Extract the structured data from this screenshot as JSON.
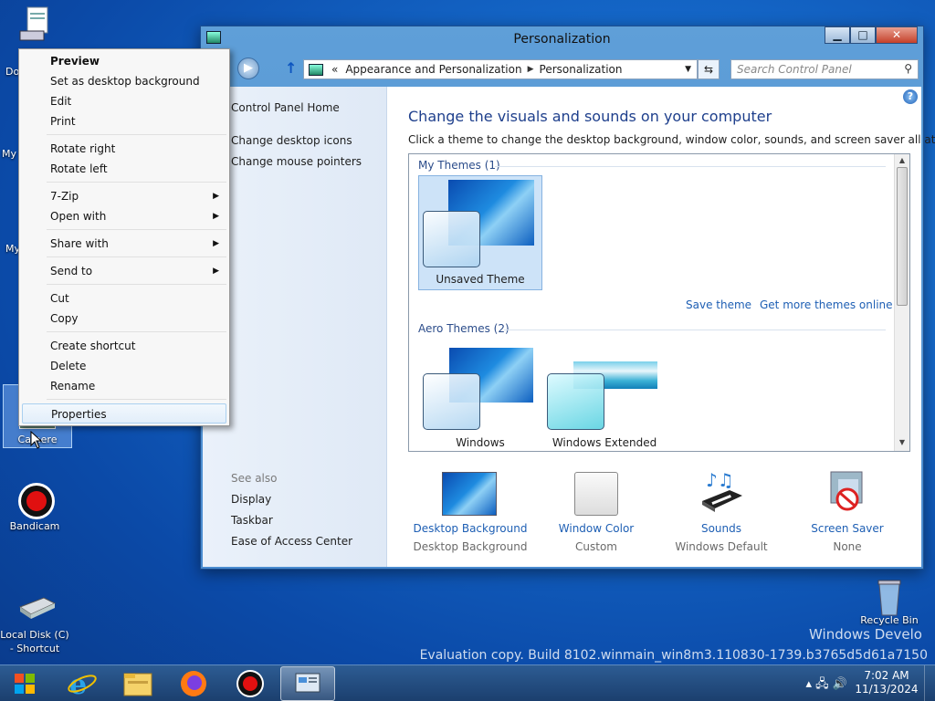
{
  "desktop": {
    "icons": {
      "documents": {
        "label": "Do"
      },
      "my1": {
        "label": "My"
      },
      "my2": {
        "label": "My"
      },
      "camera": {
        "label": "Camere"
      },
      "bandicam": {
        "label": "Bandicam"
      },
      "local_disk": {
        "label": "Local Disk (C)\n- Shortcut"
      },
      "recycle": {
        "label": "Recycle Bin"
      }
    },
    "watermark": {
      "line1": "Windows Develo",
      "line2": "Evaluation copy. Build 8102.winmain_win8m3.110830-1739.b3765d5d61a7150"
    }
  },
  "context_menu": {
    "items": [
      {
        "label": "Preview",
        "bold": true
      },
      {
        "label": "Set as desktop background"
      },
      {
        "label": "Edit"
      },
      {
        "label": "Print"
      },
      {
        "label": "Rotate right"
      },
      {
        "label": "Rotate left"
      },
      {
        "label": "7-Zip",
        "submenu": true
      },
      {
        "label": "Open with",
        "submenu": true
      },
      {
        "label": "Share with",
        "submenu": true
      },
      {
        "label": "Send to",
        "submenu": true
      },
      {
        "label": "Cut"
      },
      {
        "label": "Copy"
      },
      {
        "label": "Create shortcut"
      },
      {
        "label": "Delete"
      },
      {
        "label": "Rename"
      },
      {
        "label": "Properties",
        "hovered": true
      }
    ]
  },
  "window": {
    "title": "Personalization",
    "controls": {
      "minimize": "▁",
      "maximize": "□",
      "close": "✕"
    },
    "address": {
      "breadcrumb": [
        "Appearance and Personalization",
        "Personalization"
      ],
      "prefix": "«"
    },
    "search": {
      "placeholder": "Search Control Panel"
    },
    "left_pane": {
      "home": "Control Panel Home",
      "links": [
        "Change desktop icons",
        "Change mouse pointers"
      ],
      "see_also": "See also",
      "see_also_links": [
        "Display",
        "Taskbar",
        "Ease of Access Center"
      ]
    },
    "main": {
      "title": "Change the visuals and sounds on your computer",
      "description": "Click a theme to change the desktop background, window color, sounds, and screen saver all at once.",
      "groups": {
        "my_themes": {
          "label": "My Themes (1)",
          "items": [
            "Unsaved Theme"
          ]
        },
        "aero_themes": {
          "label": "Aero Themes (2)",
          "items": [
            "Windows",
            "Windows Extended"
          ]
        }
      },
      "links": {
        "save_theme": "Save theme",
        "more_themes": "Get more themes online"
      },
      "settings": [
        {
          "label": "Desktop Background",
          "value": "Desktop Background",
          "icon": "desktop-background-icon"
        },
        {
          "label": "Window Color",
          "value": "Custom",
          "icon": "window-color-icon"
        },
        {
          "label": "Sounds",
          "value": "Windows Default",
          "icon": "sounds-icon"
        },
        {
          "label": "Screen Saver",
          "value": "None",
          "icon": "screen-saver-icon"
        }
      ]
    }
  },
  "taskbar": {
    "clock": {
      "time": "7:02 AM",
      "date": "11/13/2024"
    },
    "tray_icons": "▴  🖧  🔊"
  }
}
